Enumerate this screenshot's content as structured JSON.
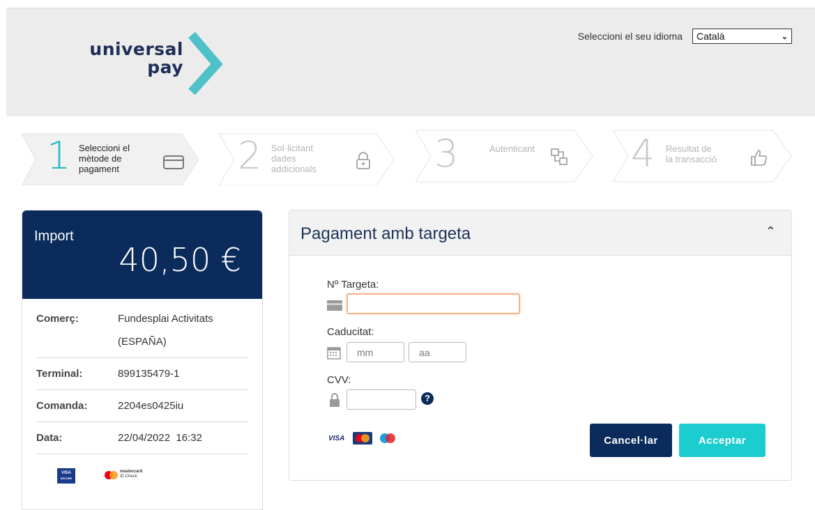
{
  "brand": {
    "line1": "universal",
    "line2": "pay"
  },
  "language": {
    "label": "Seleccioni el seu idioma",
    "selected": "Català"
  },
  "steps": [
    {
      "number": "1",
      "label": [
        "Seleccioni el",
        "mètode de",
        "pagament"
      ],
      "icon": "card-icon",
      "active": true
    },
    {
      "number": "2",
      "label": [
        "Sol·licitant",
        "dades",
        "addicionals"
      ],
      "icon": "lock-icon",
      "active": false
    },
    {
      "number": "3",
      "label": [
        "Autenticant"
      ],
      "icon": "authentication-icon",
      "active": false
    },
    {
      "number": "4",
      "label": [
        "Resultat de",
        "la transacció"
      ],
      "icon": "thumbs-up-icon",
      "active": false
    }
  ],
  "amount": {
    "label": "Import",
    "value": "40,50 €"
  },
  "details": {
    "merchant": {
      "key": "Comerç:",
      "value1": "Fundesplai Activitats",
      "value2": "(ESPAÑA)"
    },
    "terminal": {
      "key": "Terminal:",
      "value": "899135479-1"
    },
    "order": {
      "key": "Comanda:",
      "value": "2204es0425iu"
    },
    "date": {
      "key": "Data:",
      "value": "22/04/2022  16:32"
    }
  },
  "secure_logos": {
    "visa": "VISA",
    "visa_sub": "SECURE",
    "mc1": "mastercard",
    "mc2": "ID Check"
  },
  "payment": {
    "title": "Pagament amb targeta",
    "card_label": "Nº Targeta:",
    "expiry_label": "Caducitat:",
    "month_placeholder": "mm",
    "year_placeholder": "aa",
    "cvv_label": "CVV:",
    "help": "?",
    "card_brands": {
      "visa": "VISA"
    },
    "cancel": "Cancel·lar",
    "accept": "Acceptar"
  },
  "colors": {
    "navy": "#0a2b5c",
    "teal": "#2ab8c8",
    "accept": "#1ccdd0"
  }
}
